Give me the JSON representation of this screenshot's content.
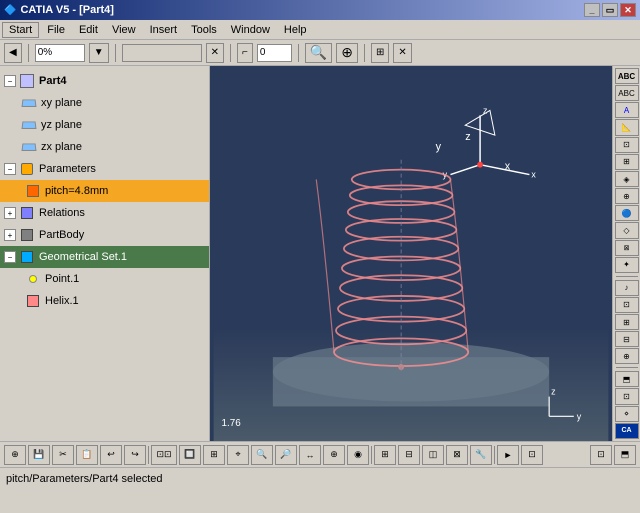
{
  "titlebar": {
    "title": "CATIA V5 - [Part4]",
    "icon": "catia-icon",
    "btns": [
      "minimize",
      "restore",
      "close"
    ]
  },
  "menubar": {
    "items": [
      "Start",
      "File",
      "Edit",
      "View",
      "Insert",
      "Tools",
      "Window",
      "Help"
    ]
  },
  "toolbar": {
    "zoom_input": "0%",
    "field_input": "0"
  },
  "tree": {
    "root": "Part4",
    "items": [
      {
        "label": "xy plane",
        "indent": 2,
        "type": "plane"
      },
      {
        "label": "yz plane",
        "indent": 2,
        "type": "plane"
      },
      {
        "label": "zx plane",
        "indent": 2,
        "type": "plane"
      },
      {
        "label": "Parameters",
        "indent": 1,
        "type": "params"
      },
      {
        "label": "pitch=4.8mm",
        "indent": 2,
        "type": "param",
        "selected": true
      },
      {
        "label": "Relations",
        "indent": 1,
        "type": "relations"
      },
      {
        "label": "PartBody",
        "indent": 1,
        "type": "body"
      },
      {
        "label": "Geometrical Set.1",
        "indent": 1,
        "type": "geoset",
        "highlighted": true
      },
      {
        "label": "Point.1",
        "indent": 2,
        "type": "point"
      },
      {
        "label": "Helix.1",
        "indent": 2,
        "type": "helix"
      }
    ]
  },
  "statusbar": {
    "text": "pitch/Parameters/Part4 selected"
  },
  "coord": {
    "label": "1.76"
  },
  "viewport": {
    "bg_color": "#2a3a5a"
  }
}
